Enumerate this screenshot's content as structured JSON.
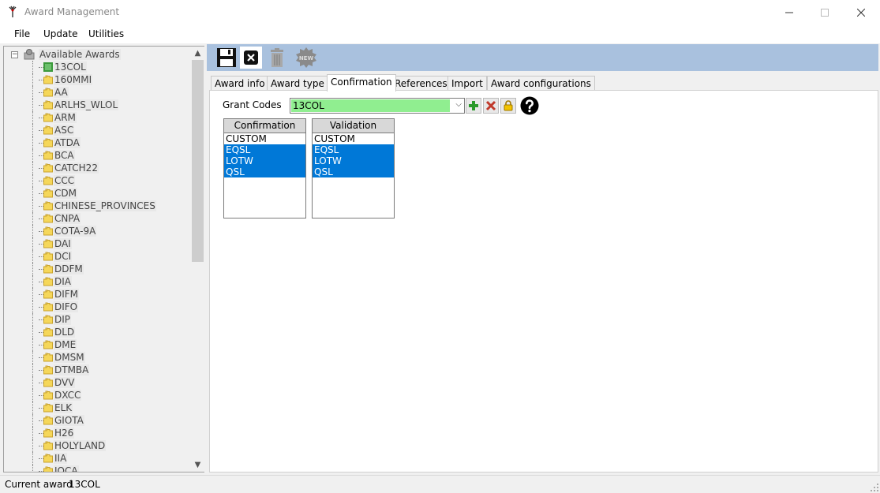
{
  "window": {
    "title": "Award Management"
  },
  "menu": {
    "items": [
      "File",
      "Update",
      "Utilities"
    ]
  },
  "tree": {
    "root_label": "Available Awards",
    "items": [
      "13COL",
      "160MMI",
      "AA",
      "ARLHS_WLOL",
      "ARM",
      "ASC",
      "ATDA",
      "BCA",
      "CATCH22",
      "CCC",
      "CDM",
      "CHINESE_PROVINCES",
      "CNPA",
      "COTA-9A",
      "DAI",
      "DCI",
      "DDFM",
      "DIA",
      "DIFM",
      "DIFO",
      "DIP",
      "DLD",
      "DME",
      "DMSM",
      "DTMBA",
      "DVV",
      "DXCC",
      "ELK",
      "GIOTA",
      "H26",
      "HOLYLAND",
      "IIA",
      "IOCA"
    ]
  },
  "toolbar": {
    "save_icon": "save-icon",
    "close_icon": "close-icon",
    "delete_icon": "trash-icon",
    "new_icon": "new-icon",
    "new_label": "NEW"
  },
  "tabs": [
    {
      "label": "Award info"
    },
    {
      "label": "Award type"
    },
    {
      "label": "Confirmation"
    },
    {
      "label": "References"
    },
    {
      "label": "Import"
    },
    {
      "label": "Award configurations"
    }
  ],
  "active_tab": "Confirmation",
  "grant": {
    "label": "Grant Codes",
    "value": "13COL"
  },
  "confirmation_list": {
    "header": "Confirmation",
    "items": [
      {
        "label": "CUSTOM",
        "selected": false
      },
      {
        "label": "EQSL",
        "selected": true
      },
      {
        "label": "LOTW",
        "selected": true
      },
      {
        "label": "QSL",
        "selected": true
      }
    ]
  },
  "validation_list": {
    "header": "Validation",
    "items": [
      {
        "label": "CUSTOM",
        "selected": false
      },
      {
        "label": "EQSL",
        "selected": true
      },
      {
        "label": "LOTW",
        "selected": true
      },
      {
        "label": "QSL",
        "selected": true
      }
    ]
  },
  "status": {
    "label": "Current award",
    "value": "13COL"
  },
  "colors": {
    "accent": "#0078d7",
    "toolbar_bg": "#a9c1de",
    "grant_bg": "#90ee90"
  }
}
